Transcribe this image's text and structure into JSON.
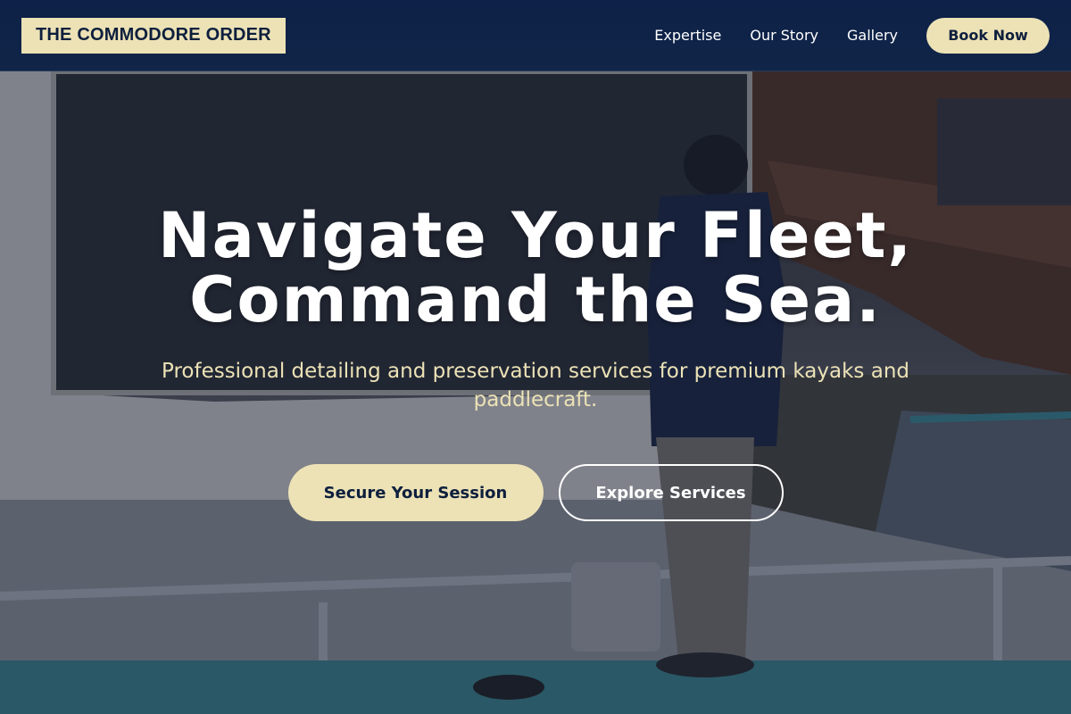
{
  "header": {
    "brand": "THE COMMODORE ORDER",
    "nav": [
      {
        "label": "Expertise"
      },
      {
        "label": "Our Story"
      },
      {
        "label": "Gallery"
      }
    ],
    "cta_label": "Book Now"
  },
  "hero": {
    "title_line1": "Navigate Your Fleet,",
    "title_line2": "Command the Sea.",
    "subtitle": "Professional detailing and preservation services for premium kayaks and paddlecraft.",
    "primary_label": "Secure Your Session",
    "secondary_label": "Explore Services"
  },
  "colors": {
    "navy": "#0e2148",
    "cream": "#ece2b6",
    "white": "#ffffff"
  }
}
